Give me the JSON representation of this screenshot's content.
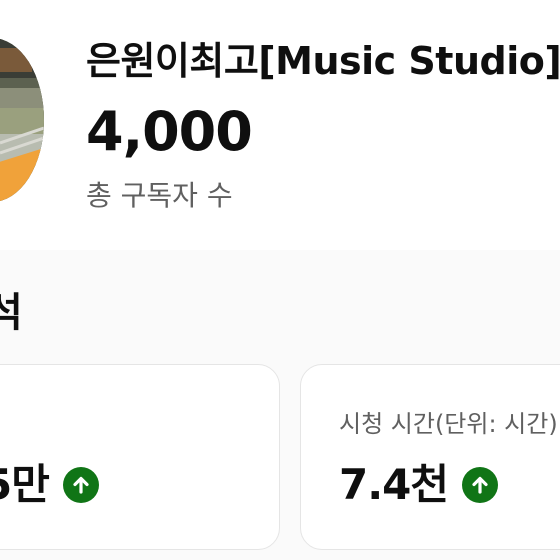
{
  "channel": {
    "name": "은원이최고[Music Studio]",
    "subscriber_count": "4,000",
    "subscriber_label": "총 구독자 수"
  },
  "analytics": {
    "section_title": "석",
    "cards": [
      {
        "label": "",
        "value": "5만",
        "trend_icon": "arrow-up-circle-icon",
        "trend_color": "#107516"
      },
      {
        "label": "시청 시간(단위: 시간)",
        "value": "7.4천",
        "trend_icon": "arrow-up-circle-icon",
        "trend_color": "#107516"
      }
    ]
  }
}
